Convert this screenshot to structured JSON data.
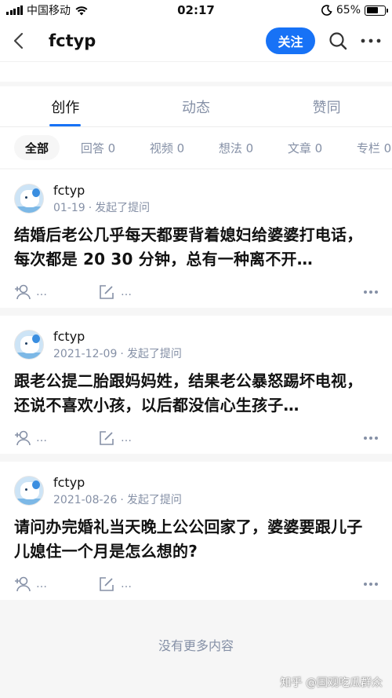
{
  "status_bar": {
    "carrier": "中国移动",
    "time": "02:17",
    "battery": "65%",
    "battery_level": 0.65
  },
  "header": {
    "title": "fctyp",
    "follow_label": "关注"
  },
  "tabs": [
    {
      "label": "创作",
      "active": true
    },
    {
      "label": "动态",
      "active": false
    },
    {
      "label": "赞同",
      "active": false
    }
  ],
  "filters": [
    {
      "label": "全部",
      "active": true
    },
    {
      "label": "回答 0",
      "active": false
    },
    {
      "label": "视频 0",
      "active": false
    },
    {
      "label": "想法 0",
      "active": false
    },
    {
      "label": "文章 0",
      "active": false
    },
    {
      "label": "专栏 0",
      "active": false
    }
  ],
  "cards": [
    {
      "author": "fctyp",
      "date": "01-19",
      "action": "发起了提问",
      "title": "结婚后老公几乎每天都要背着媳妇给婆婆打电话，每次都是 20 30 分钟，总有一种离不开…",
      "invite_text": "…",
      "write_text": "…"
    },
    {
      "author": "fctyp",
      "date": "2021-12-09",
      "action": "发起了提问",
      "title": "跟老公提二胎跟妈妈姓，结果老公暴怒踢坏电视，还说不喜欢小孩，以后都没信心生孩子…",
      "invite_text": "…",
      "write_text": "…"
    },
    {
      "author": "fctyp",
      "date": "2021-08-26",
      "action": "发起了提问",
      "title": "请问办完婚礼当天晚上公公回家了，婆婆要跟儿子儿媳住一个月是怎么想的?",
      "invite_text": "…",
      "write_text": "…"
    }
  ],
  "empty_text": "没有更多内容",
  "watermark": "知乎 @国观吃瓜群众",
  "icons": {
    "back": "chevron-left-icon",
    "search": "search-icon",
    "more": "more-icon",
    "invite": "add-user-icon",
    "write": "edit-icon"
  }
}
